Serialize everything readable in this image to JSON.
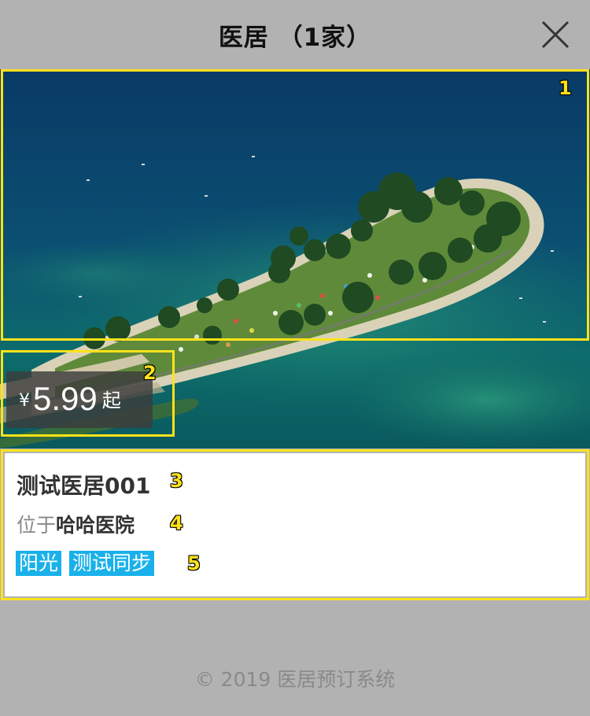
{
  "header": {
    "title": "医居 （1家）"
  },
  "hotel": {
    "price_symbol": "¥",
    "price_value": "5.99",
    "price_suffix": "起",
    "name": "测试医居001",
    "location_prefix": "位于",
    "location_name": "哈哈医院",
    "tags": [
      "阳光",
      "测试同步"
    ]
  },
  "annotations": [
    "1",
    "2",
    "3",
    "4",
    "5"
  ],
  "footer": {
    "copyright": "© 2019 医居预订系统"
  },
  "colors": {
    "background": "#b2b2b2",
    "annotation": "#ffe21a",
    "tag": "#1ab1ea"
  }
}
